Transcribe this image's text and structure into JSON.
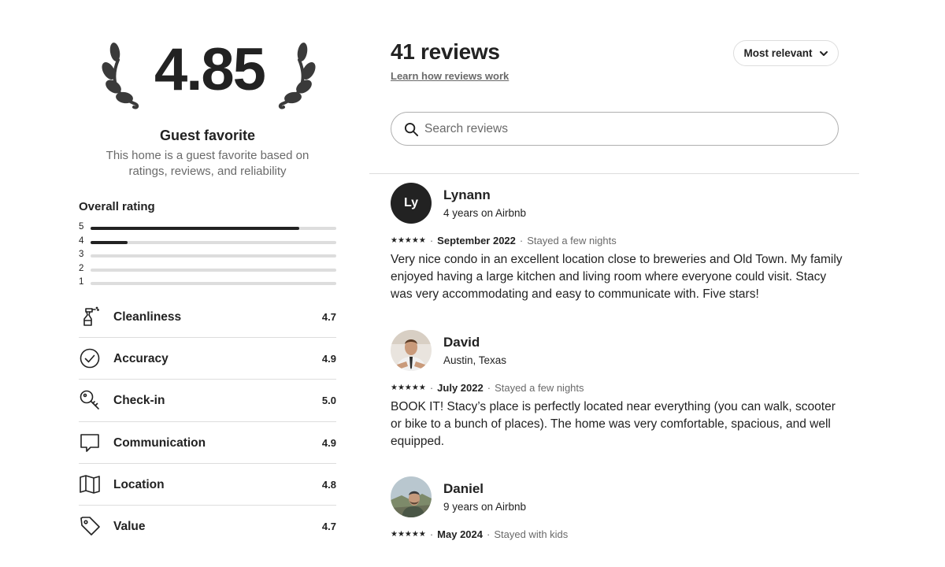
{
  "summary": {
    "rating": "4.85",
    "badge_title": "Guest favorite",
    "badge_desc": "This home is a guest favorite based on ratings, reviews, and reliability"
  },
  "overall": {
    "title": "Overall rating",
    "bars": [
      {
        "star": "5",
        "fraction": 0.85
      },
      {
        "star": "4",
        "fraction": 0.15
      },
      {
        "star": "3",
        "fraction": 0.0
      },
      {
        "star": "2",
        "fraction": 0.0
      },
      {
        "star": "1",
        "fraction": 0.0
      }
    ]
  },
  "categories": [
    {
      "label": "Cleanliness",
      "value": "4.7",
      "icon": "spray-bottle-icon"
    },
    {
      "label": "Accuracy",
      "value": "4.9",
      "icon": "check-circle-icon"
    },
    {
      "label": "Check-in",
      "value": "5.0",
      "icon": "key-icon"
    },
    {
      "label": "Communication",
      "value": "4.9",
      "icon": "chat-bubble-icon"
    },
    {
      "label": "Location",
      "value": "4.8",
      "icon": "map-icon"
    },
    {
      "label": "Value",
      "value": "4.7",
      "icon": "tag-icon"
    }
  ],
  "header": {
    "count_label": "41 reviews",
    "learn_link": "Learn how reviews work",
    "sort_label": "Most relevant"
  },
  "search": {
    "placeholder": "Search reviews",
    "value": ""
  },
  "reviews": [
    {
      "name": "Lynann",
      "initials": "Ly",
      "subtitle": "4 years on Airbnb",
      "stars": "★★★★★",
      "date": "September 2022",
      "stay": "Stayed a few nights",
      "text": "Very nice condo in an excellent location close to breweries and Old Town.  My family enjoyed having a large kitchen and living room where everyone could visit. Stacy was very accommodating and easy to communicate with.  Five stars!"
    },
    {
      "name": "David",
      "subtitle": "Austin, Texas",
      "stars": "★★★★★",
      "date": "July 2022",
      "stay": "Stayed a few nights",
      "text": "BOOK IT! Stacy’s place is perfectly located near everything (you can walk, scooter or bike to a bunch of places). The home was very comfortable, spacious, and well equipped."
    },
    {
      "name": "Daniel",
      "subtitle": "9 years on Airbnb",
      "stars": "★★★★★",
      "date": "May 2024",
      "stay": "Stayed with kids",
      "text": ""
    }
  ],
  "colors": {
    "text": "#222222",
    "muted": "#6a6a6a",
    "border": "#dddddd"
  }
}
